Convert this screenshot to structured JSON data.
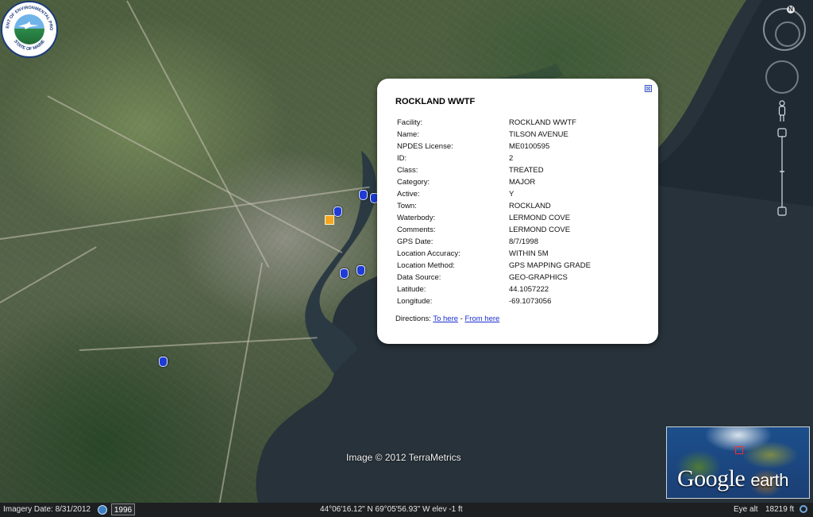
{
  "logo": {
    "top_text": "DEPARTMENT OF ENVIRONMENTAL PROTECTION",
    "bottom_text": "STATE OF MAINE"
  },
  "nav": {
    "north_label": "N"
  },
  "balloon": {
    "title": "ROCKLAND WWTF",
    "close_symbol": "⊠",
    "attributes": [
      {
        "key": "Facility:",
        "value": "ROCKLAND WWTF"
      },
      {
        "key": "Name:",
        "value": "TILSON AVENUE"
      },
      {
        "key": "NPDES License:",
        "value": "ME0100595"
      },
      {
        "key": "ID:",
        "value": "2"
      },
      {
        "key": "Class:",
        "value": "TREATED"
      },
      {
        "key": "Category:",
        "value": "MAJOR"
      },
      {
        "key": "Active:",
        "value": "Y"
      },
      {
        "key": "Town:",
        "value": "ROCKLAND"
      },
      {
        "key": "Waterbody:",
        "value": "LERMOND COVE"
      },
      {
        "key": "Comments:",
        "value": "LERMOND COVE"
      },
      {
        "key": "GPS Date:",
        "value": "8/7/1998"
      },
      {
        "key": "Location Accuracy:",
        "value": "WITHIN 5M"
      },
      {
        "key": "Location Method:",
        "value": "GPS MAPPING GRADE"
      },
      {
        "key": "Data Source:",
        "value": "GEO-GRAPHICS"
      },
      {
        "key": "Latitude:",
        "value": "44.1057222"
      },
      {
        "key": "Longitude:",
        "value": "-69.1073056"
      }
    ],
    "directions_label": "Directions:",
    "to_here": "To here",
    "separator": " - ",
    "from_here": "From here"
  },
  "map": {
    "copyright": "Image © 2012 TerraMetrics",
    "overview_logo_google": "Google",
    "overview_logo_earth": "earth"
  },
  "status": {
    "imagery_date": "Imagery Date: 8/31/2012",
    "year": "1996",
    "coordinates": "44°06'16.12\" N  69°05'56.93\" W  elev   -1 ft",
    "eye_alt_label": "Eye alt",
    "eye_alt_value": "18219 ft"
  },
  "colors": {
    "marker": "#1e3bd6",
    "selected_marker": "#f5a623",
    "link": "#1a2fd0",
    "status_bar": "#1d1f21"
  }
}
